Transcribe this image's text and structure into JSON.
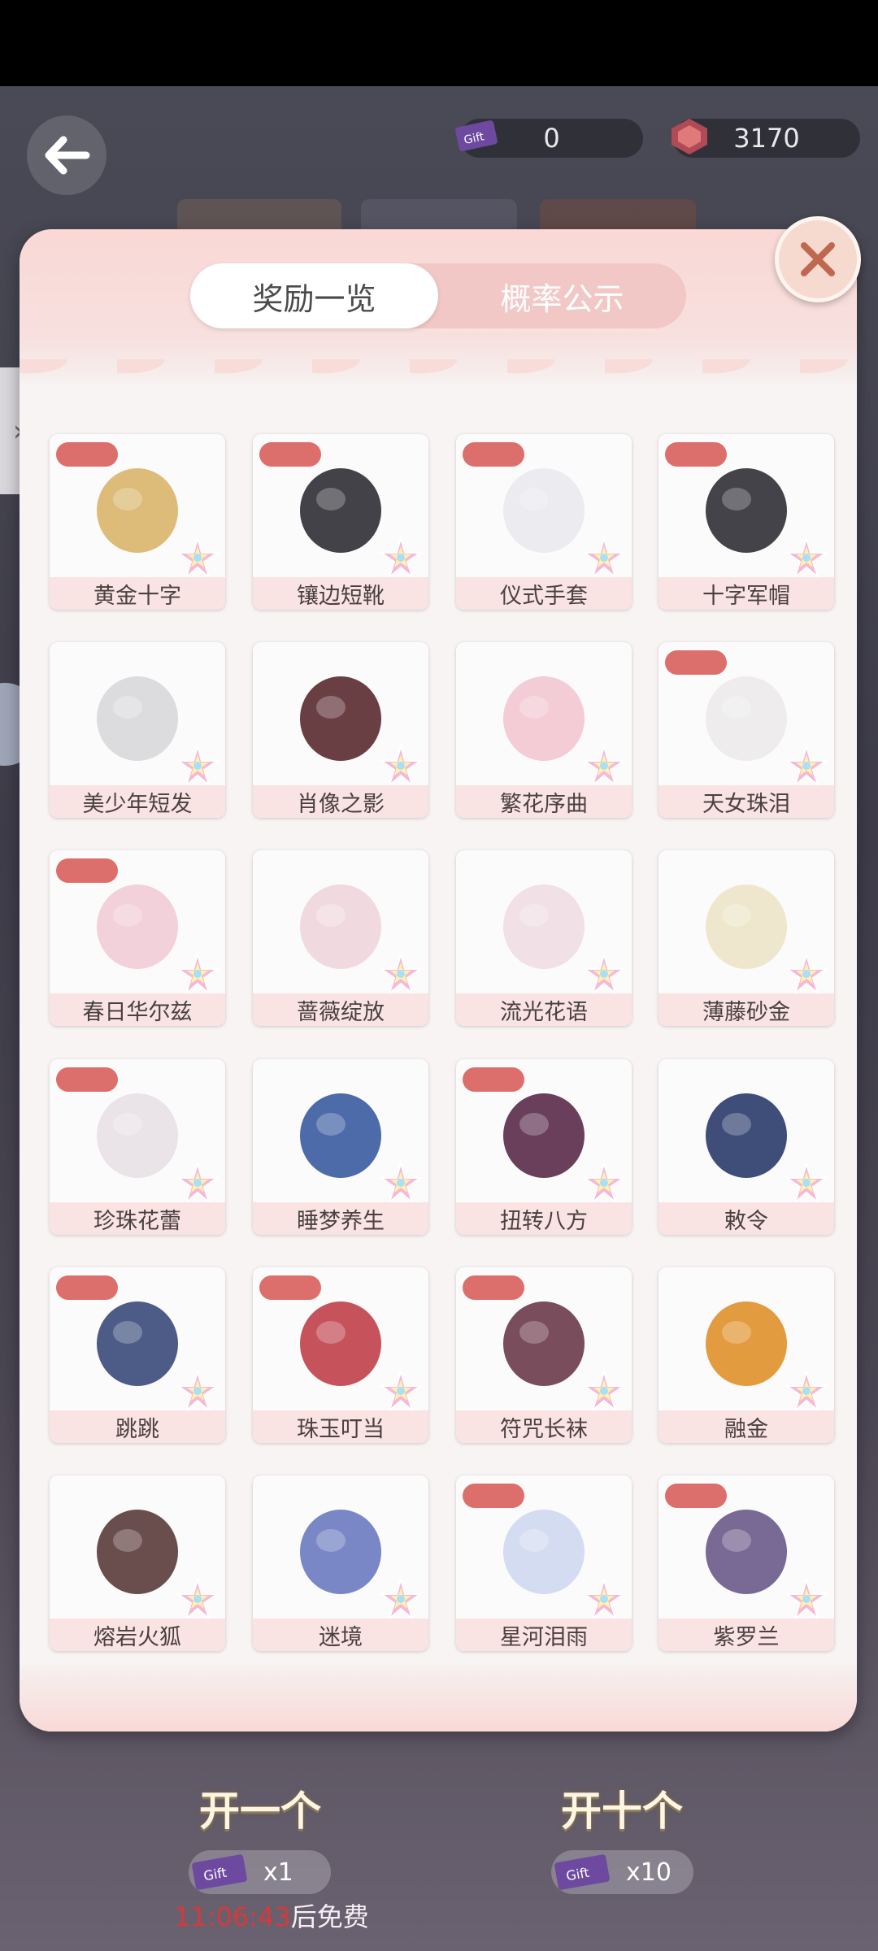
{
  "currency": {
    "tickets": "0",
    "gems": "3170"
  },
  "modal": {
    "tabs": [
      {
        "label": "奖励一览",
        "active": true
      },
      {
        "label": "概率公示",
        "active": false
      }
    ],
    "items": [
      {
        "name": "黄金十字",
        "tag": true,
        "icon": "gold-cross-earrings-icon"
      },
      {
        "name": "镶边短靴",
        "tag": true,
        "icon": "ankle-boots-icon"
      },
      {
        "name": "仪式手套",
        "tag": true,
        "icon": "white-gloves-icon"
      },
      {
        "name": "十字军帽",
        "tag": true,
        "icon": "military-cap-icon"
      },
      {
        "name": "美少年短发",
        "tag": false,
        "icon": "white-short-hair-icon"
      },
      {
        "name": "肖像之影",
        "tag": false,
        "icon": "dark-coat-outfit-icon"
      },
      {
        "name": "繁花序曲",
        "tag": false,
        "icon": "pink-dress-icon"
      },
      {
        "name": "天女珠泪",
        "tag": true,
        "icon": "pearl-headband-icon"
      },
      {
        "name": "春日华尔兹",
        "tag": true,
        "icon": "pink-shoes-icon"
      },
      {
        "name": "蔷薇绽放",
        "tag": false,
        "icon": "lace-gloves-icon"
      },
      {
        "name": "流光花语",
        "tag": false,
        "icon": "lace-fan-icon"
      },
      {
        "name": "薄藤砂金",
        "tag": false,
        "icon": "blonde-hair-icon"
      },
      {
        "name": "珍珠花蕾",
        "tag": true,
        "icon": "pearl-earrings-icon"
      },
      {
        "name": "睡梦养生",
        "tag": false,
        "icon": "blue-jacket-icon"
      },
      {
        "name": "扭转八方",
        "tag": true,
        "icon": "braided-hair-icon"
      },
      {
        "name": "敕令",
        "tag": false,
        "icon": "cat-ear-hat-icon"
      },
      {
        "name": "跳跳",
        "tag": true,
        "icon": "blue-boots-icon"
      },
      {
        "name": "珠玉叮当",
        "tag": true,
        "icon": "tassel-earrings-icon"
      },
      {
        "name": "符咒长袜",
        "tag": true,
        "icon": "long-stockings-icon"
      },
      {
        "name": "融金",
        "tag": false,
        "icon": "golden-eyes-icon"
      },
      {
        "name": "熔岩火狐",
        "tag": false,
        "icon": "makeup-card-sweet-icon"
      },
      {
        "name": "迷境",
        "tag": false,
        "icon": "galaxy-eyes-icon"
      },
      {
        "name": "星河泪雨",
        "tag": true,
        "icon": "makeup-card-fantasy-icon"
      },
      {
        "name": "紫罗兰",
        "tag": true,
        "icon": "purple-eyes-icon"
      }
    ]
  },
  "bottom": {
    "open_one": "开一个",
    "open_ten": "开十个",
    "cost_one": "x1",
    "cost_ten": "x10",
    "free_time": "11:06:43",
    "free_suffix": "后免费",
    "ticket_icon_text": "Gift"
  },
  "colors": {
    "tag": "#dc6e6b",
    "tab_bg": "#f2c8c6",
    "label_bg": "#f9e4e3",
    "free_time": "#d43a3a"
  }
}
